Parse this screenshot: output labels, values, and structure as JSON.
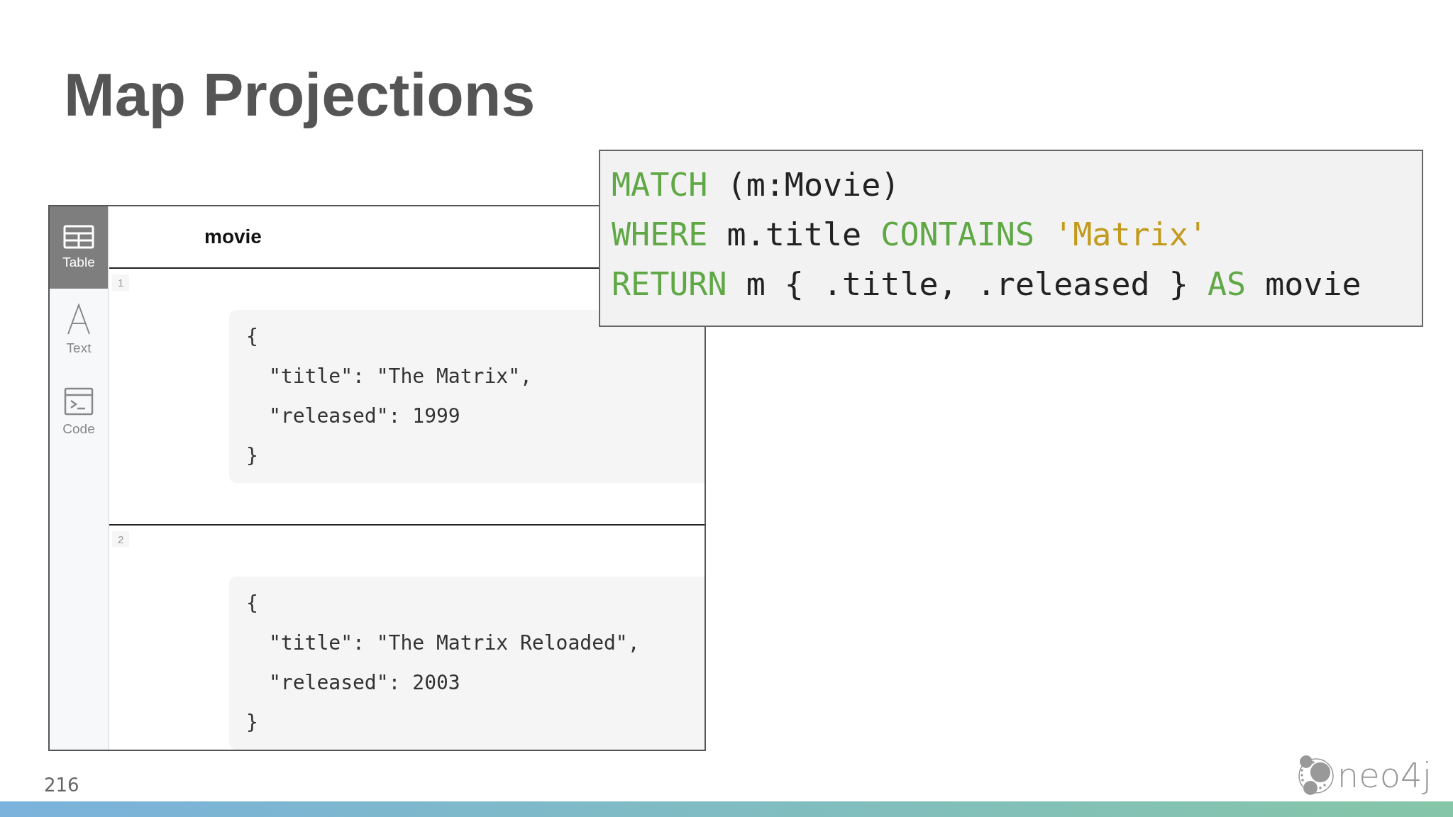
{
  "slide": {
    "title": "Map Projections",
    "page_number": "216",
    "logo": {
      "text": "neo4j"
    }
  },
  "result_frame": {
    "sidebar": [
      {
        "kind": "table",
        "label": "Table",
        "selected": true
      },
      {
        "kind": "text",
        "label": "Text",
        "selected": false
      },
      {
        "kind": "code",
        "label": "Code",
        "selected": false
      }
    ],
    "column_header": "movie",
    "rows": [
      {
        "index": "1",
        "lines": [
          {
            "kind": "brace",
            "text": "{"
          },
          {
            "kind": "field",
            "text": "\"title\": \"The Matrix\","
          },
          {
            "kind": "field",
            "text": "\"released\": 1999"
          },
          {
            "kind": "brace",
            "text": "}"
          }
        ]
      },
      {
        "index": "2",
        "lines": [
          {
            "kind": "brace",
            "text": "{"
          },
          {
            "kind": "field",
            "text": "\"title\": \"The Matrix Reloaded\","
          },
          {
            "kind": "field",
            "text": "\"released\": 2003"
          },
          {
            "kind": "brace",
            "text": "}"
          }
        ]
      }
    ]
  },
  "query": {
    "lines": [
      [
        {
          "kind": "keyword",
          "text": "MATCH"
        },
        {
          "kind": "plain",
          "text": " (m:Movie)"
        }
      ],
      [
        {
          "kind": "keyword",
          "text": "WHERE"
        },
        {
          "kind": "plain",
          "text": " m.title "
        },
        {
          "kind": "keyword",
          "text": "CONTAINS "
        },
        {
          "kind": "string",
          "text": "'Matrix'"
        }
      ],
      [
        {
          "kind": "keyword",
          "text": "RETURN"
        },
        {
          "kind": "plain",
          "text": " m { .title, .released } "
        },
        {
          "kind": "keyword",
          "text": "AS"
        },
        {
          "kind": "plain",
          "text": " movie"
        }
      ]
    ]
  }
}
